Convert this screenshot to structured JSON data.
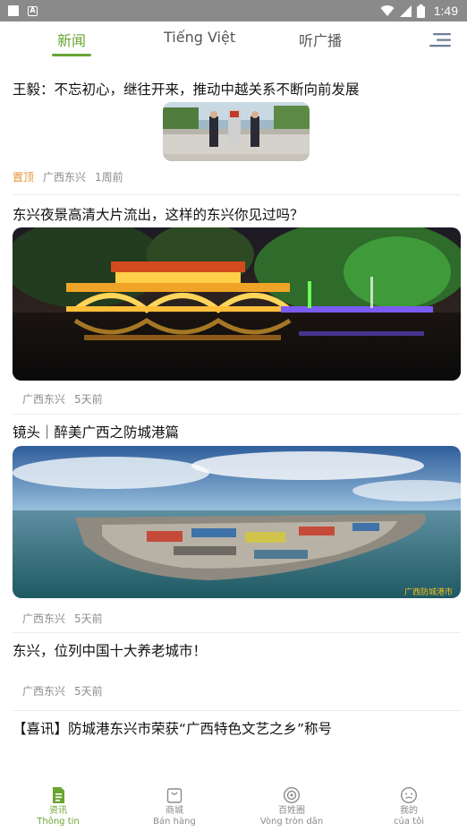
{
  "status_bar": {
    "time": "1:49",
    "battery_level": "8",
    "icons": [
      "notification-square-icon",
      "a-app-icon",
      "wifi-icon",
      "signal-icon",
      "battery-icon"
    ]
  },
  "top_tabs": [
    {
      "label": "新闻",
      "active": true
    },
    {
      "label": "Tiếng Việt",
      "active": false
    },
    {
      "label": "听广播",
      "active": false
    }
  ],
  "articles": [
    {
      "title": "王毅：不忘初心，继往开来，推动中越关系不断向前发展",
      "pinned_label": "置顶",
      "source": "广西东兴",
      "time": "1周前",
      "image": "diplomats-at-border-marker"
    },
    {
      "title": "东兴夜景高清大片流出，这样的东兴你见过吗？",
      "source": "广西东兴",
      "time": "5天前",
      "image": "night-bridge-lights"
    },
    {
      "title": "镜头｜醉美广西之防城港篇",
      "source": "广西东兴",
      "time": "5天前",
      "image": "port-aerial-view",
      "watermark": "广西防城港市"
    },
    {
      "title": "东兴，位列中国十大养老城市！",
      "source": "广西东兴",
      "time": "5天前"
    },
    {
      "title": "【喜讯】防城港东兴市荣获“广西特色文艺之乡”称号"
    }
  ],
  "bottom_nav": [
    {
      "label": "资讯",
      "sub": "Thông tin",
      "icon": "news-doc-icon",
      "active": true
    },
    {
      "label": "商城",
      "sub": "Bán hàng",
      "icon": "shop-bag-icon",
      "active": false
    },
    {
      "label": "百姓圈",
      "sub": "Vòng tròn dân",
      "icon": "community-circle-icon",
      "active": false
    },
    {
      "label": "我的",
      "sub": "của tôi",
      "icon": "profile-face-icon",
      "active": false
    }
  ],
  "colors": {
    "accent": "#6aa532",
    "pinned": "#e8943a",
    "meta": "#8c8c8c",
    "status_bar": "#8a8a8a"
  }
}
